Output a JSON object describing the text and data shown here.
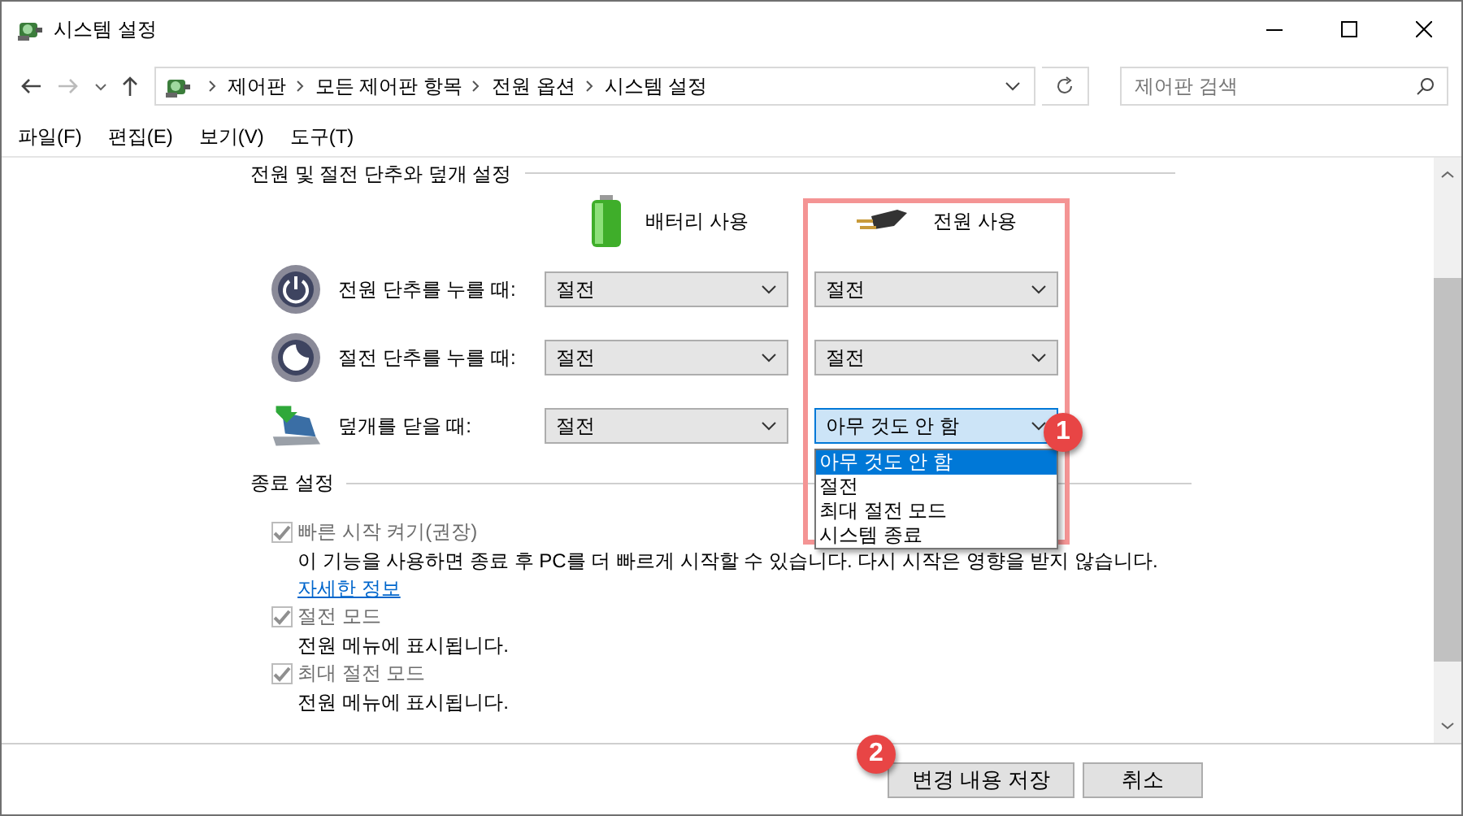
{
  "window": {
    "title": "시스템 설정"
  },
  "address_bar": {
    "breadcrumbs": [
      "제어판",
      "모든 제어판 항목",
      "전원 옵션",
      "시스템 설정"
    ]
  },
  "search": {
    "placeholder": "제어판 검색"
  },
  "menu": [
    "파일(F)",
    "편집(E)",
    "보기(V)",
    "도구(T)"
  ],
  "power_section": {
    "title": "전원 및 절전 단추와 덮개 설정",
    "columns": [
      {
        "kind": "battery",
        "label": "배터리 사용"
      },
      {
        "kind": "plug",
        "label": "전원 사용"
      }
    ],
    "rows": [
      {
        "kind": "power",
        "label": "전원 단추를 누를 때:",
        "battery": "절전",
        "ac": "절전",
        "ac_open": false
      },
      {
        "kind": "sleep",
        "label": "절전 단추를 누를 때:",
        "battery": "절전",
        "ac": "절전",
        "ac_open": false
      },
      {
        "kind": "lid",
        "label": "덮개를 닫을 때:",
        "battery": "절전",
        "ac": "아무 것도 안 함",
        "ac_open": true
      }
    ]
  },
  "dropdown": {
    "options": [
      {
        "label": "아무 것도 안 함",
        "selected": true
      },
      {
        "label": "절전",
        "selected": false
      },
      {
        "label": "최대 절전 모드",
        "selected": false
      },
      {
        "label": "시스템 종료",
        "selected": false
      }
    ]
  },
  "shutdown_section": {
    "title": "종료 설정",
    "items": [
      {
        "label": "빠른 시작 켜기(권장)",
        "checked": true,
        "disabled": true,
        "description": "이 기능을 사용하면 종료 후 PC를 더 빠르게 시작할 수 있습니다. 다시 시작은 영향을 받지 않습니다.",
        "link": "자세한 정보"
      },
      {
        "label": "절전 모드",
        "checked": true,
        "disabled": true,
        "description": "전원 메뉴에 표시됩니다."
      },
      {
        "label": "최대 절전 모드",
        "checked": true,
        "disabled": true,
        "description": "전원 메뉴에 표시됩니다."
      }
    ]
  },
  "buttons": [
    {
      "label": "변경 내용 저장"
    },
    {
      "label": "취소"
    }
  ],
  "annotations": [
    {
      "label": "1"
    },
    {
      "label": "2"
    }
  ]
}
